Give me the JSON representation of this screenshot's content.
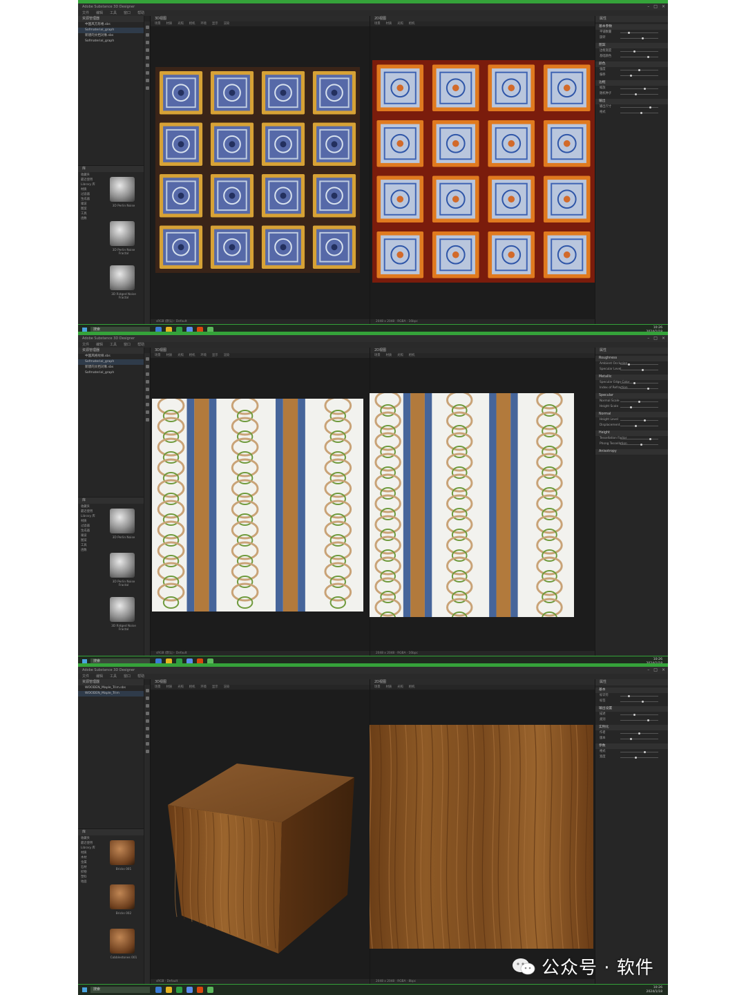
{
  "app": {
    "title": "Adobe Substance 3D Designer",
    "menu": [
      "文件",
      "编辑",
      "工具",
      "窗口",
      "帮助"
    ]
  },
  "panels": {
    "explorer_title": "资源管理器",
    "viewport_3d_title": "3D视图",
    "viewport_2d_title": "2D视图",
    "viewport_menu": [
      "场景",
      "材质",
      "光照",
      "相机",
      "环境",
      "显示",
      "渲染"
    ],
    "properties_title": "属性",
    "library_title": "库"
  },
  "screens": [
    {
      "explorer_items": [
        "中国风方形格.sbs",
        "Sofmaterial_graph",
        "新建的文档对象.sbs",
        "Sofmaterial_graph"
      ],
      "footer_3d": "sRGB (默认) · Default",
      "footer_2d": "2048 x 2048 · RGBA · 16bpc",
      "properties": {
        "sections": [
          "基本参数",
          "图案",
          "颜色",
          "边框",
          "输出"
        ],
        "rows": [
          "平铺数量",
          "旋转",
          "边框宽度",
          "基础颜色",
          "强度",
          "偏移",
          "缩放",
          "随机种子",
          "输出尺寸",
          "格式"
        ]
      },
      "library_tree": [
        "收藏夹",
        "最近使用",
        "Library 库",
        "材质",
        "过滤器",
        "生成器",
        "噪波",
        "图案",
        "工具",
        "函数"
      ],
      "library_thumbs": [
        "3D Perlin Noise",
        "3D Perlin Noise Fractal",
        "3D Ridged Noise Fractal"
      ]
    },
    {
      "explorer_items": [
        "中国风格纹样.sbs",
        "Sofmaterial_graph",
        "新建的文档对象.sbs",
        "Sofmaterial_graph"
      ],
      "footer_3d": "sRGB (默认) · Default",
      "footer_2d": "2048 x 2048 · RGBA · 16bpc",
      "properties": {
        "sections": [
          "Roughness",
          "Metallic",
          "Specular",
          "Normal",
          "Height",
          "Anisotropy"
        ],
        "rows": [
          "Ambient Occlusion",
          "Specular Level",
          "Specular Edge Color",
          "Index of Refraction",
          "Normal Scale",
          "Height Scale",
          "Height Level",
          "Displacement",
          "Tessellation Factor",
          "Phong Tessellation"
        ]
      },
      "library_tree": [
        "收藏夹",
        "最近使用",
        "Library 库",
        "材质",
        "过滤器",
        "生成器",
        "噪波",
        "图案",
        "工具",
        "函数"
      ],
      "library_thumbs": [
        "3D Perlin Noise",
        "3D Perlin Noise Fractal",
        "3D Ridged Noise Fractal"
      ]
    },
    {
      "explorer_items": [
        "WOODEN_Maple_Trim.sbs",
        "WOODEN_Maple_Trim"
      ],
      "footer_3d": "sRGB · Default",
      "footer_2d": "2048 x 2048 · RGBA · 8bpc",
      "properties": {
        "sections": [
          "基本",
          "输出设置",
          "实例化",
          "参数"
        ],
        "rows": [
          "标识符",
          "标签",
          "描述",
          "类别",
          "作者",
          "版本",
          "格式",
          "宽度",
          "高度",
          "位深"
        ]
      },
      "library_tree": [
        "收藏夹",
        "最近使用",
        "Library 库",
        "材质",
        "木材",
        "金属",
        "石材",
        "织物",
        "塑料",
        "地面"
      ],
      "library_thumbs": [
        "Bricks 001",
        "Bricks 002",
        "Cobblestones 001"
      ]
    }
  ],
  "taskbar": {
    "search": "搜索",
    "time": "10:26",
    "date": "2024/1/18"
  },
  "watermark": {
    "text": "公众号 · 软件",
    "icon": "wechat-icon"
  },
  "colors": {
    "accent_green": "#35a33a",
    "ui_bg": "#242424",
    "viewport_bg": "#1c1c1c",
    "tile_blue": "#4a5f9e",
    "frame_gold": "#c9902e",
    "tile_red": "#8a2410",
    "wood": "#8a5524"
  }
}
